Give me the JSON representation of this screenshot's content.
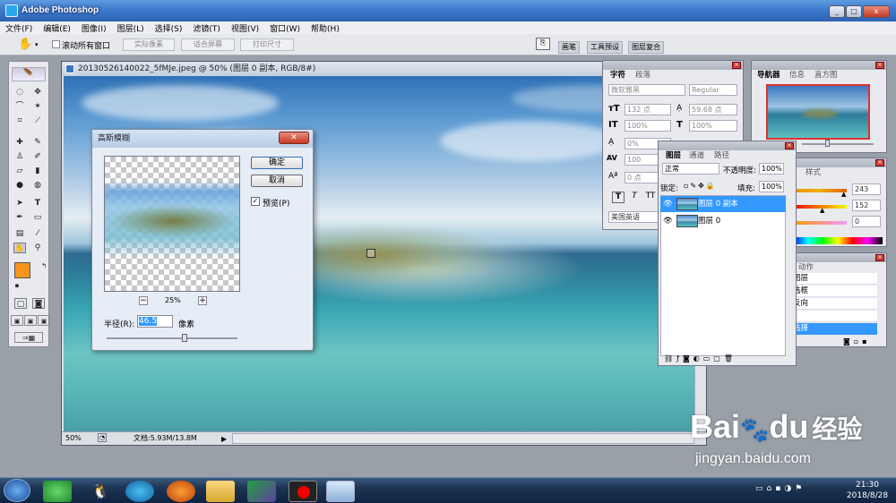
{
  "app": {
    "title": "Adobe Photoshop"
  },
  "window_buttons": [
    "_",
    "□",
    "x"
  ],
  "menu": [
    "文件(F)",
    "编辑(E)",
    "图像(I)",
    "图层(L)",
    "选择(S)",
    "滤镜(T)",
    "视图(V)",
    "窗口(W)",
    "帮助(H)"
  ],
  "options": {
    "scroll_all": "滚动所有窗口",
    "actual_pixels": "实际像素",
    "fit_screen": "适合屏幕",
    "print_size": "打印尺寸",
    "tabs": [
      "画笔",
      "工具预设",
      "图层复合"
    ]
  },
  "document": {
    "title": "20130526140022_5fMJe.jpeg @ 50% (图层 0 副本, RGB/8#)",
    "zoom": "50%",
    "doc_info": "文档:5.93M/13.8M"
  },
  "gaussian": {
    "title": "高斯模糊",
    "ok": "确定",
    "cancel": "取消",
    "preview_label": "预览(P)",
    "preview_checked": true,
    "zoom": "25%",
    "radius_label": "半径(R):",
    "radius_value": "46.5",
    "unit": "像素",
    "minus": "−",
    "plus": "+"
  },
  "character": {
    "tabs": [
      "字符",
      "段落"
    ],
    "font": "微软雅黑",
    "style": "Regular",
    "size": "132 点",
    "leading": "59.68 点",
    "vscale": "100%",
    "hscale": "100%",
    "tracking": "0%",
    "kerning": "100",
    "baseline": "0 点",
    "language": "美国英语"
  },
  "navigator": {
    "tabs": [
      "导航器",
      "信息",
      "直方图"
    ]
  },
  "color": {
    "tab": "样式",
    "values": [
      "243",
      "152",
      "0"
    ]
  },
  "layers": {
    "tabs": [
      "图层",
      "通道",
      "路径"
    ],
    "blend": "正常",
    "opacity_label": "不透明度:",
    "opacity": "100%",
    "lock_label": "锁定:",
    "fill_label": "填充:",
    "fill": "100%",
    "items": [
      {
        "name": "图层 0 副本",
        "selected": true
      },
      {
        "name": "图层 0",
        "selected": false
      }
    ]
  },
  "history": {
    "tab": "动作",
    "items": [
      "图层",
      "选框",
      "反向",
      "",
      "选择"
    ]
  },
  "taskbar": {
    "time": "21:30",
    "date": "2018/8/28"
  },
  "watermark": {
    "brand_part1": "Bai",
    "brand_part2": "du",
    "brand_cn": "经验",
    "url": "jingyan.baidu.com"
  },
  "colors": {
    "foreground": "#f7941d",
    "selection": "#3399ff",
    "title_blue": "#3a76c8"
  }
}
